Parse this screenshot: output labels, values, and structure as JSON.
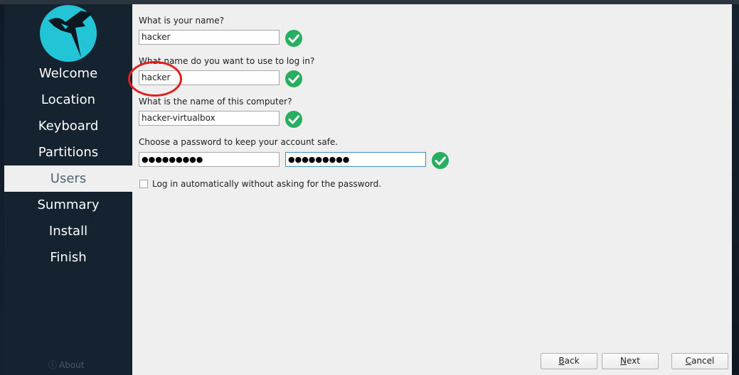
{
  "sidebar": {
    "items": [
      {
        "label": "Welcome"
      },
      {
        "label": "Location"
      },
      {
        "label": "Keyboard"
      },
      {
        "label": "Partitions"
      },
      {
        "label": "Users"
      },
      {
        "label": "Summary"
      },
      {
        "label": "Install"
      },
      {
        "label": "Finish"
      }
    ],
    "active": "Users",
    "about_label": "About",
    "about_icon": "info-icon"
  },
  "form": {
    "name_question": "What is your name?",
    "name_value": "hacker",
    "login_question": "What name do you want to use to log in?",
    "login_value": "hacker",
    "computer_question": "What is the name of this computer?",
    "computer_value": "hacker-virtualbox",
    "password_question": "Choose a password to keep your account safe.",
    "password_value": "●●●●●●●●●",
    "password_confirm_value": "●●●●●●●●●",
    "autologin_label": "Log in automatically without asking for the password.",
    "autologin_checked": false
  },
  "buttons": {
    "back_mnemonic": "B",
    "back_rest": "ack",
    "next_mnemonic": "N",
    "next_rest": "ext",
    "cancel_mnemonic": "C",
    "cancel_rest": "ancel"
  },
  "colors": {
    "accent_check": "#27ae60",
    "sidebar_bg": "#14232f",
    "logo_bg": "#23c4d6",
    "annotation": "#e0201e"
  }
}
